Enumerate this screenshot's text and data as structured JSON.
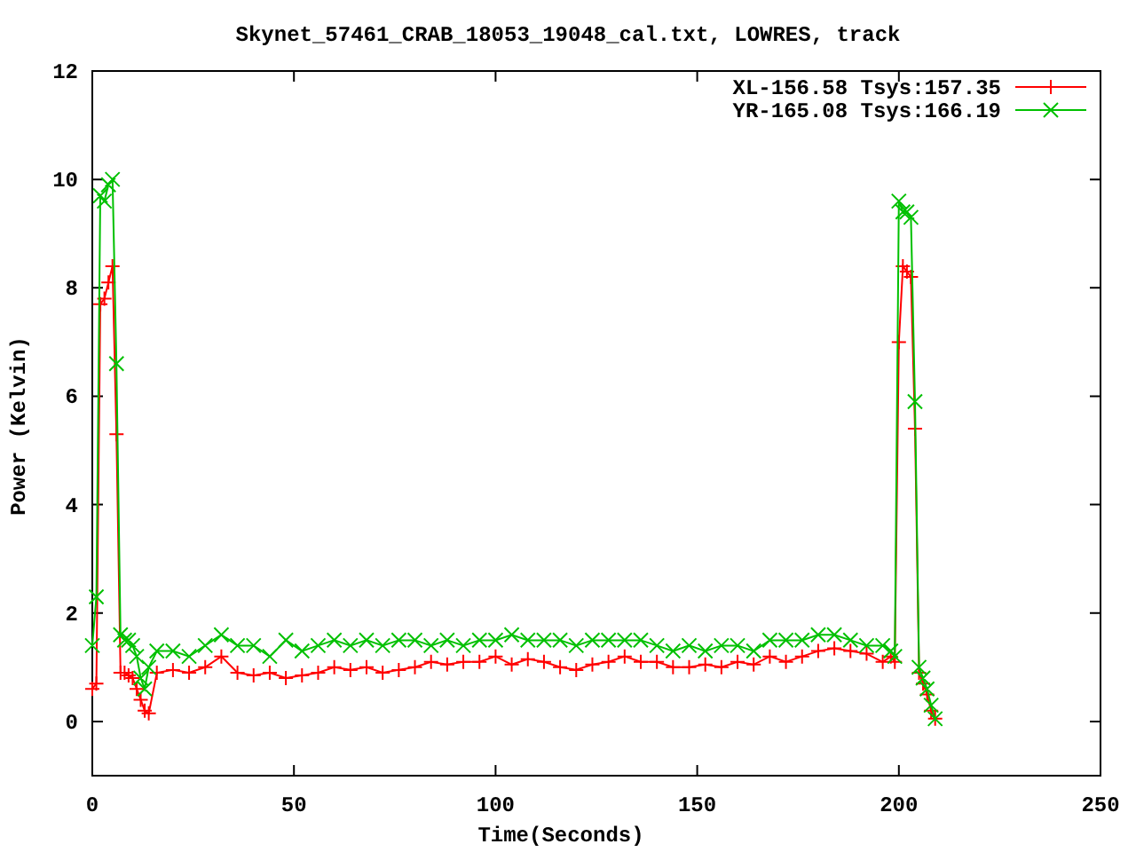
{
  "chart_data": {
    "type": "line",
    "title": "Skynet_57461_CRAB_18053_19048_cal.txt, LOWRES, track",
    "xlabel": "Time(Seconds)",
    "ylabel": "Power (Kelvin)",
    "x": [
      0,
      1,
      2,
      3,
      4,
      5,
      6,
      7,
      8,
      9,
      10,
      11,
      12,
      13,
      14,
      16,
      20,
      24,
      28,
      32,
      36,
      40,
      44,
      48,
      52,
      56,
      60,
      64,
      68,
      72,
      76,
      80,
      84,
      88,
      92,
      96,
      100,
      104,
      108,
      112,
      116,
      120,
      124,
      128,
      132,
      136,
      140,
      144,
      148,
      152,
      156,
      160,
      164,
      168,
      172,
      176,
      180,
      184,
      188,
      192,
      196,
      198,
      199,
      200,
      201,
      202,
      203,
      204,
      205,
      206,
      207,
      208,
      209
    ],
    "series": [
      {
        "name": "XL-156.58 Tsys:157.35",
        "color": "#ff0000",
        "marker": "plus",
        "values": [
          0.6,
          0.7,
          7.7,
          7.8,
          8.1,
          8.4,
          5.3,
          0.9,
          0.9,
          0.85,
          0.8,
          0.6,
          0.4,
          0.2,
          0.15,
          0.9,
          0.95,
          0.9,
          1.0,
          1.2,
          0.9,
          0.85,
          0.9,
          0.8,
          0.85,
          0.9,
          1.0,
          0.95,
          1.0,
          0.9,
          0.95,
          1.0,
          1.1,
          1.05,
          1.1,
          1.1,
          1.2,
          1.05,
          1.15,
          1.1,
          1.0,
          0.95,
          1.05,
          1.1,
          1.2,
          1.1,
          1.1,
          1.0,
          1.0,
          1.05,
          1.0,
          1.1,
          1.05,
          1.2,
          1.1,
          1.2,
          1.3,
          1.35,
          1.3,
          1.25,
          1.1,
          1.2,
          1.1,
          7.0,
          8.4,
          8.3,
          8.2,
          5.4,
          0.9,
          0.7,
          0.5,
          0.2,
          0.05
        ]
      },
      {
        "name": "YR-165.08 Tsys:166.19",
        "color": "#00c000",
        "marker": "x",
        "values": [
          1.4,
          2.3,
          9.7,
          9.6,
          9.9,
          10.0,
          6.6,
          1.6,
          1.5,
          1.5,
          1.4,
          1.2,
          0.8,
          0.6,
          1.0,
          1.3,
          1.3,
          1.2,
          1.4,
          1.6,
          1.4,
          1.4,
          1.2,
          1.5,
          1.3,
          1.4,
          1.5,
          1.4,
          1.5,
          1.4,
          1.5,
          1.5,
          1.4,
          1.5,
          1.4,
          1.5,
          1.5,
          1.6,
          1.5,
          1.5,
          1.5,
          1.4,
          1.5,
          1.5,
          1.5,
          1.5,
          1.4,
          1.3,
          1.4,
          1.3,
          1.4,
          1.4,
          1.3,
          1.5,
          1.5,
          1.5,
          1.6,
          1.6,
          1.5,
          1.4,
          1.4,
          1.3,
          1.2,
          9.6,
          9.4,
          9.4,
          9.3,
          5.9,
          1.0,
          0.8,
          0.6,
          0.3,
          0.05
        ]
      }
    ],
    "legend": true,
    "xlim": [
      0,
      250
    ],
    "ylim": [
      -1,
      12
    ],
    "xticks": [
      0,
      50,
      100,
      150,
      200,
      250
    ],
    "yticks": [
      0,
      2,
      4,
      6,
      8,
      10,
      12
    ]
  }
}
